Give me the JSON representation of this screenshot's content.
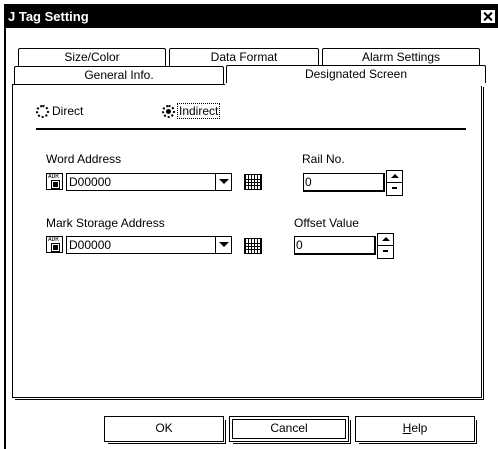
{
  "window": {
    "title": "J Tag Setting"
  },
  "tabs": {
    "row1": [
      "Size/Color",
      "Data Format",
      "Alarm Settings"
    ],
    "row2": [
      "General Info.",
      "Designated Screen"
    ],
    "active": "Designated Screen"
  },
  "mode": {
    "options": [
      "Direct",
      "Indirect"
    ],
    "selected": "Indirect"
  },
  "word_address": {
    "label": "Word Address",
    "value": "D00000"
  },
  "rail_no": {
    "label": "Rail No.",
    "value": "0"
  },
  "mark_storage_address": {
    "label": "Mark Storage Address",
    "value": "D00000"
  },
  "offset_value": {
    "label": "Offset Value",
    "value": "0"
  },
  "address_icon": {
    "name": "address-input-icon",
    "text": "ADR"
  },
  "buttons": {
    "ok": "OK",
    "cancel": "Cancel",
    "help_prefix": "H",
    "help_rest": "elp"
  },
  "icons": {
    "close": "close-icon",
    "dropdown": "chevron-down-icon",
    "keypad": "keypad-icon",
    "spin_up": "spin-up-icon",
    "spin_down": "spin-down-icon",
    "radio": "radio-button-icon"
  }
}
